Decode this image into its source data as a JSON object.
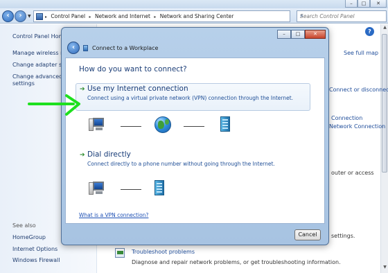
{
  "window": {
    "controls": {
      "minimize": "–",
      "maximize": "□",
      "close": "✕"
    },
    "address_crumbs": [
      "Control Panel",
      "Network and Internet",
      "Network and Sharing Center"
    ],
    "search_placeholder": "Search Control Panel",
    "help_glyph": "?"
  },
  "left_pane": {
    "home": "Control Panel Home",
    "links": [
      "Manage wireless networks",
      "Change adapter settings",
      "Change advanced sharing",
      "settings"
    ],
    "see_also_heading": "See also",
    "see_also": [
      "HomeGroup",
      "Internet Options",
      "Windows Firewall"
    ]
  },
  "main_background": {
    "see_full_map": "See full map",
    "connect_disconnect": "Connect or disconnect",
    "connection_1": "Connection",
    "connection_2": "Network Connection",
    "router": "outer or access",
    "settings": "settings.",
    "troubleshoot_title": "Troubleshoot problems",
    "troubleshoot_desc": "Diagnose and repair network problems, or get troubleshooting information."
  },
  "dialog": {
    "title": "Connect to a Workplace",
    "question": "How do you want to connect?",
    "options": [
      {
        "title": "Use my Internet connection",
        "description": "Connect using a virtual private network (VPN) connection through the Internet."
      },
      {
        "title": "Dial directly",
        "description": "Connect directly to a phone number without going through the Internet."
      }
    ],
    "vpn_link": "What is a VPN connection?",
    "cancel": "Cancel"
  },
  "colors": {
    "annotation_arrow": "#1ee01e",
    "link_blue": "#1c4fb4",
    "title_blue": "#163a76"
  },
  "icons": [
    "back-arrow-icon",
    "forward-arrow-icon",
    "computer-icon",
    "globe-icon",
    "building-icon",
    "green-arrow-icon",
    "search-icon"
  ]
}
